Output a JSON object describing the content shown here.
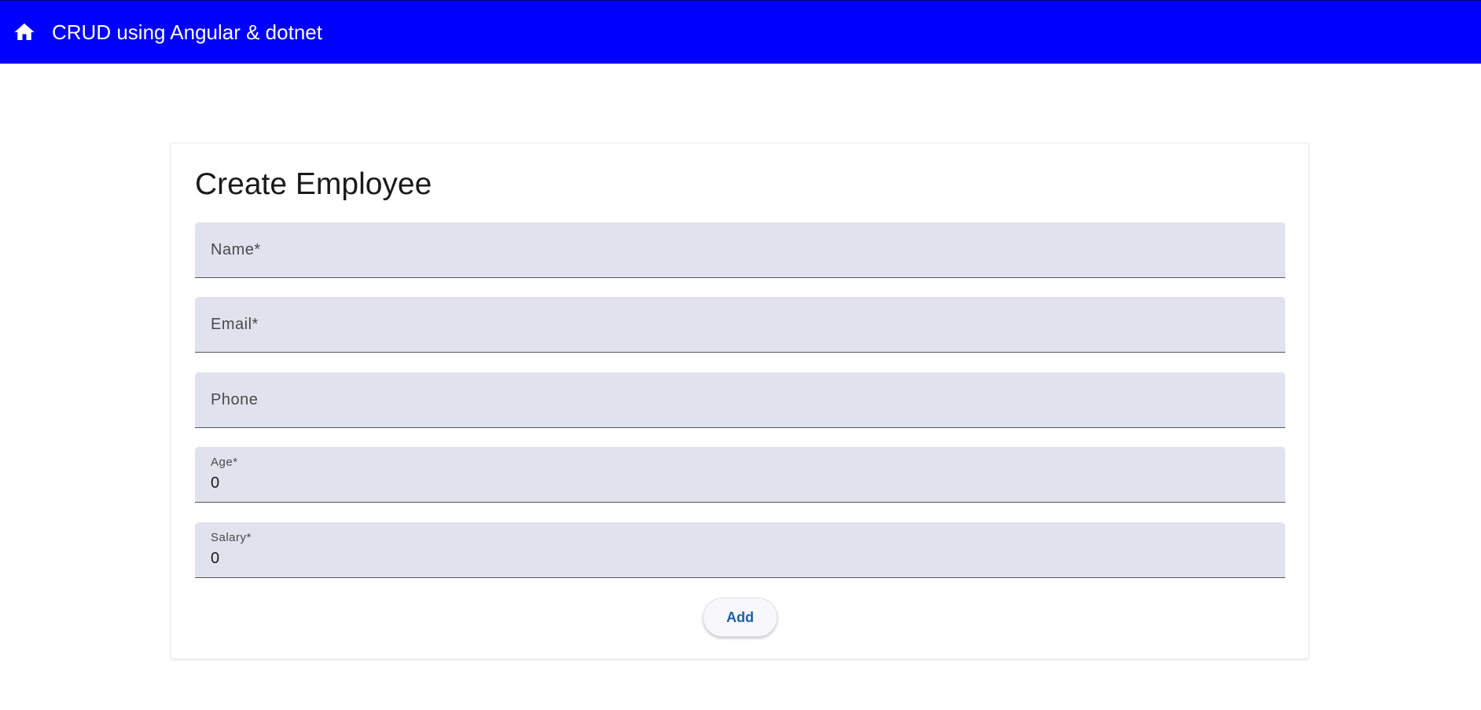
{
  "colors": {
    "toolbar_bg": "#0000ff",
    "field_bg": "#e0e3ed",
    "button_bg": "#f7f7fc",
    "button_text": "#1a5fa8"
  },
  "toolbar": {
    "home_icon": "home-icon",
    "title": "CRUD using Angular & dotnet"
  },
  "form": {
    "title": "Create Employee",
    "fields": {
      "name": {
        "label": "Name*",
        "value": ""
      },
      "email": {
        "label": "Email*",
        "value": ""
      },
      "phone": {
        "label": "Phone",
        "value": ""
      },
      "age": {
        "label": "Age*",
        "value": "0"
      },
      "salary": {
        "label": "Salary*",
        "value": "0"
      }
    },
    "submit_label": "Add"
  }
}
